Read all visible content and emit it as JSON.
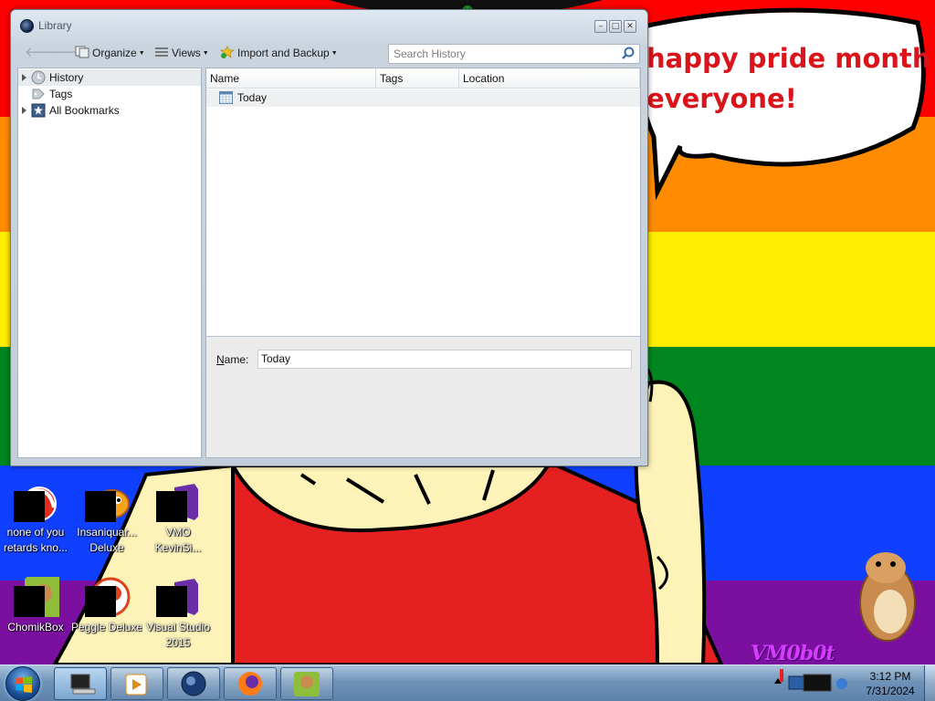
{
  "window": {
    "title": "Library",
    "toolbar": {
      "organize_label": "Organize",
      "views_label": "Views",
      "import_label": "Import and Backup",
      "search_placeholder": "Search History"
    },
    "sidebar": {
      "items": [
        {
          "label": "History",
          "icon": "history-clock-icon",
          "selected": true,
          "expandable": true
        },
        {
          "label": "Tags",
          "icon": "tag-icon",
          "selected": false,
          "expandable": false
        },
        {
          "label": "All Bookmarks",
          "icon": "bookmarks-star-icon",
          "selected": false,
          "expandable": true
        }
      ]
    },
    "columns": [
      "Name",
      "Tags",
      "Location"
    ],
    "rows": [
      {
        "name": "Today",
        "icon": "calendar-icon"
      }
    ],
    "details": {
      "name_label": "Name:",
      "name_value": "Today"
    }
  },
  "wallpaper": {
    "bubble_line1": "happy pride month",
    "bubble_line2": "everyone!",
    "logo_text": "VM0b0t",
    "colors": [
      "#ff0000",
      "#ff8c00",
      "#ffee00",
      "#00861f",
      "#0f3fff",
      "#7a0fa0"
    ]
  },
  "desktop_icons": [
    {
      "label1": "none of you",
      "label2": "retards kno..."
    },
    {
      "label1": "Insaniquar...",
      "label2": "Deluxe"
    },
    {
      "label1": "VMO",
      "label2": "KevinSi..."
    },
    {
      "label1": "ChomikBox",
      "label2": ""
    },
    {
      "label1": "Peggle Deluxe",
      "label2": ""
    },
    {
      "label1": "Visual Studio",
      "label2": "2015"
    }
  ],
  "taskbar": {
    "time": "3:12 PM",
    "date": "7/31/2024"
  }
}
